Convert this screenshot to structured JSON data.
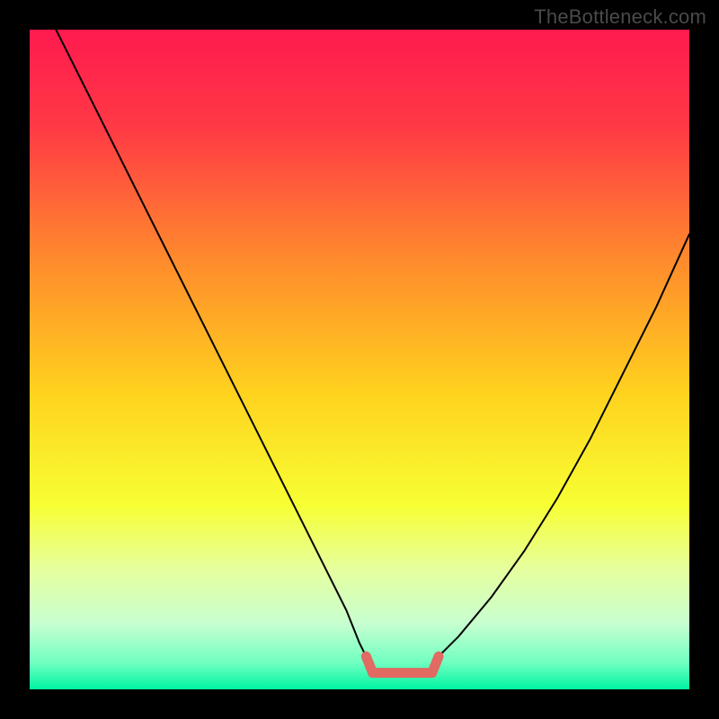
{
  "watermark": "TheBottleneck.com",
  "chart_data": {
    "type": "line",
    "title": "",
    "xlabel": "",
    "ylabel": "",
    "xlim": [
      0,
      100
    ],
    "ylim": [
      0,
      100
    ],
    "grid": false,
    "series": [
      {
        "name": "main-curve-left",
        "color": "#000000",
        "x": [
          4,
          10,
          20,
          30,
          40,
          48,
          50,
          51
        ],
        "y": [
          100,
          88,
          68,
          48,
          28,
          12,
          7,
          5
        ]
      },
      {
        "name": "main-curve-right",
        "color": "#000000",
        "x": [
          62,
          65,
          70,
          75,
          80,
          85,
          90,
          95,
          100
        ],
        "y": [
          5,
          8,
          14,
          21,
          29,
          38,
          48,
          58,
          69
        ]
      },
      {
        "name": "flat-bottom-marker",
        "color": "#e16a62",
        "x": [
          51,
          52,
          55,
          58,
          61,
          62
        ],
        "y": [
          5,
          2.5,
          2.5,
          2.5,
          2.5,
          5
        ]
      }
    ],
    "background_gradient": {
      "stops": [
        {
          "offset": 0.0,
          "color": "#ff1a4f"
        },
        {
          "offset": 0.15,
          "color": "#ff3a45"
        },
        {
          "offset": 0.35,
          "color": "#ff8b2c"
        },
        {
          "offset": 0.55,
          "color": "#ffd21e"
        },
        {
          "offset": 0.72,
          "color": "#f7ff33"
        },
        {
          "offset": 0.82,
          "color": "#e5ffa0"
        },
        {
          "offset": 0.9,
          "color": "#c8ffd0"
        },
        {
          "offset": 0.96,
          "color": "#6fffc0"
        },
        {
          "offset": 1.0,
          "color": "#00f4a3"
        }
      ]
    }
  }
}
